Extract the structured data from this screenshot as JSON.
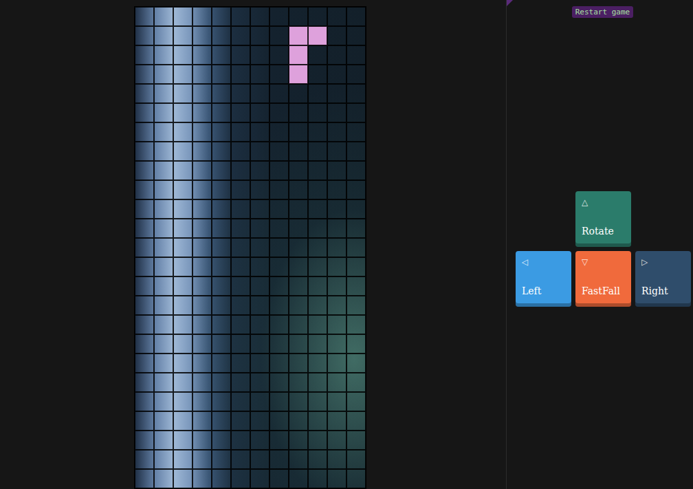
{
  "restart": {
    "label": "Restart game"
  },
  "board": {
    "columns": 12,
    "rows": 25,
    "piece": {
      "color": "#dea1dc",
      "cells": [
        {
          "row": 1,
          "col": 8
        },
        {
          "row": 1,
          "col": 9
        },
        {
          "row": 2,
          "col": 8
        },
        {
          "row": 3,
          "col": 8
        }
      ]
    }
  },
  "controls": [
    {
      "glyph": "△",
      "label": "Rotate",
      "color": "#2b7c6b",
      "slot": "top"
    },
    {
      "glyph": "◁",
      "label": "Left",
      "color": "#3b9be3",
      "slot": "left"
    },
    {
      "glyph": "▽",
      "label": "FastFall",
      "color": "#f06a3c",
      "slot": "middle"
    },
    {
      "glyph": "▷",
      "label": "Right",
      "color": "#2f4d6b",
      "slot": "right"
    }
  ]
}
